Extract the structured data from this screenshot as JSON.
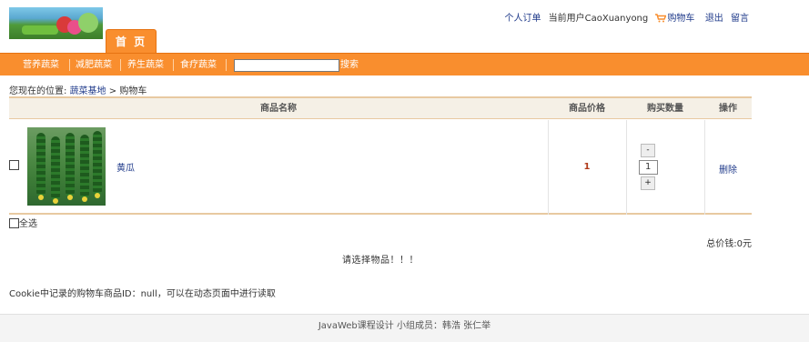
{
  "header": {
    "links": {
      "orders": "个人订单",
      "current_user": "当前用户CaoXuanyong",
      "cart": "购物车",
      "logout": "退出",
      "message": "留言"
    },
    "home_tab": "首 页"
  },
  "nav": {
    "items": [
      "营养蔬菜",
      "减肥蔬菜",
      "养生蔬菜",
      "食疗蔬菜"
    ],
    "search_value": "",
    "search_button": "搜索"
  },
  "breadcrumb": {
    "prefix": "您现在的位置:",
    "home": "蔬菜基地",
    "separator": ">",
    "current": "购物车"
  },
  "table": {
    "headers": [
      "商品名称",
      "商品价格",
      "购买数量",
      "操作"
    ],
    "rows": [
      {
        "name": "黄瓜",
        "price": "1",
        "quantity": "1",
        "minus": "-",
        "plus": "+",
        "action": "删除"
      }
    ]
  },
  "select_all": "全选",
  "total": "总价钱:0元",
  "notice": "请选择物品！！！",
  "cookie_info": "Cookie中记录的购物车商品ID：null，可以在动态页面中进行读取",
  "footer": "JavaWeb课程设计 小组成员：韩浩 张仁举",
  "colors": {
    "accent": "#f98e2e",
    "link": "#1f3a8a",
    "price": "#b03a1a",
    "table_border": "#e8c9a1"
  }
}
